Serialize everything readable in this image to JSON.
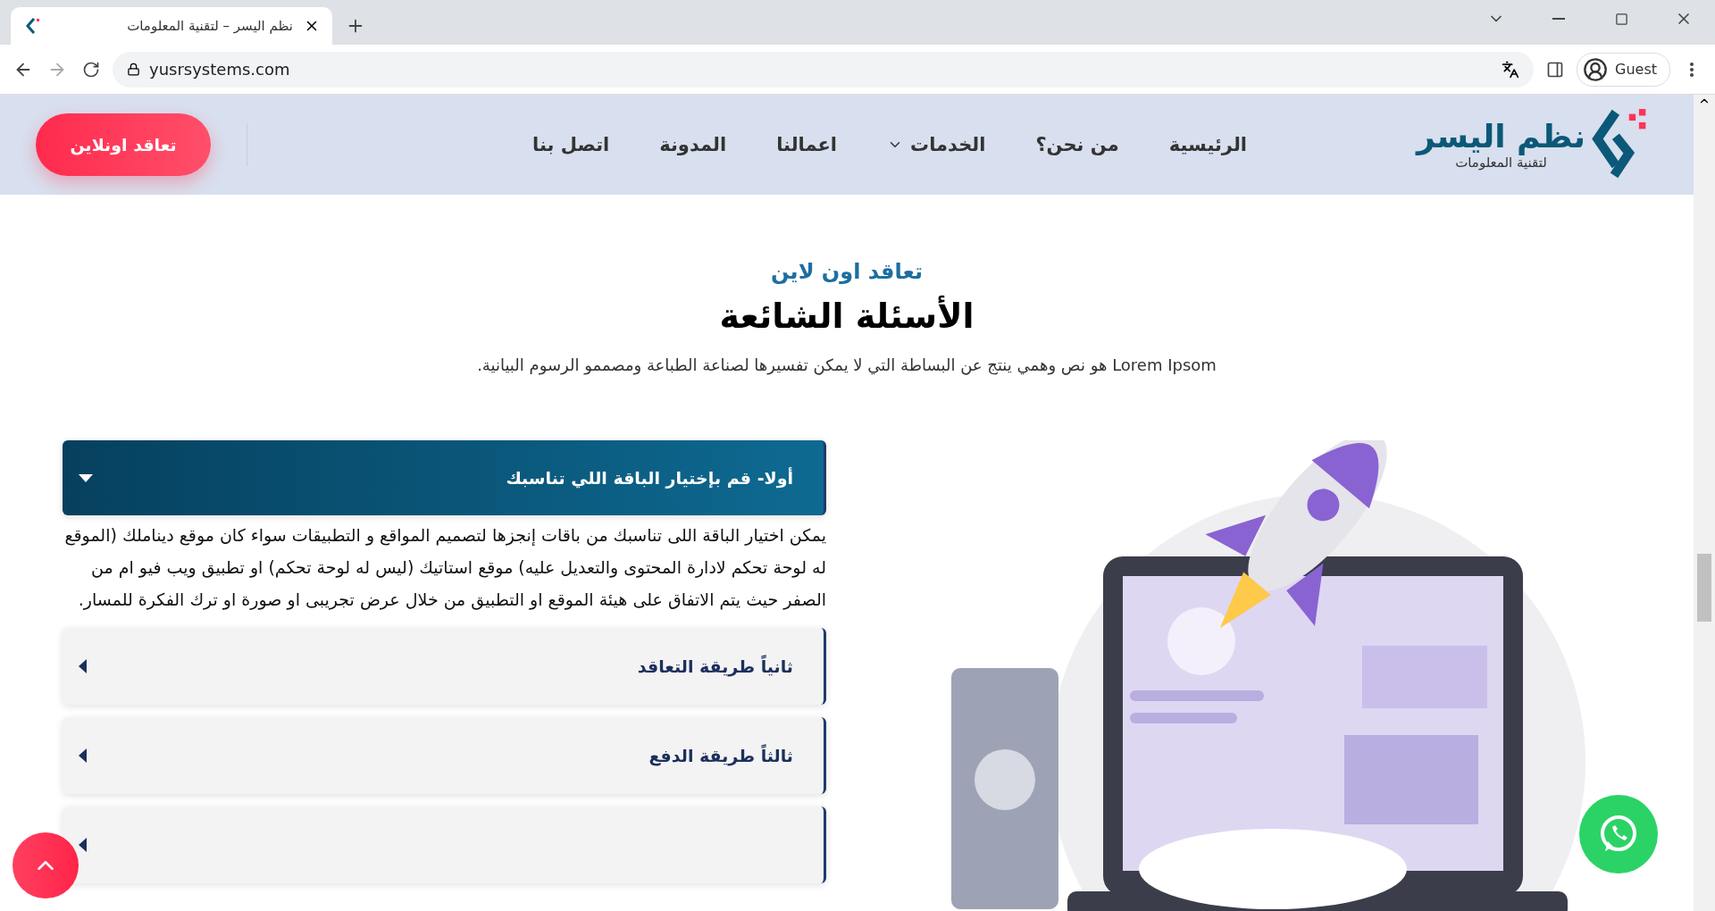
{
  "browser": {
    "tab_title": "نظم اليسر – لتقنية المعلومات",
    "url": "yusrsystems.com",
    "profile": "Guest"
  },
  "nav": {
    "logo_title": "نظم اليسر",
    "logo_subtitle": "لتقنية المعلومات",
    "items": [
      {
        "label": "الرئيسية",
        "has_dropdown": false
      },
      {
        "label": "من نحن؟",
        "has_dropdown": false
      },
      {
        "label": "الخدمات",
        "has_dropdown": true
      },
      {
        "label": "اعمالنا",
        "has_dropdown": false
      },
      {
        "label": "المدونة",
        "has_dropdown": false
      },
      {
        "label": "اتصل بنا",
        "has_dropdown": false
      }
    ],
    "cta": "تعاقد اونلاين"
  },
  "hero": {
    "eyebrow": "تعاقد اون لاين",
    "title": "الأسئلة الشائعة",
    "description": "Lorem Ipsom هو نص وهمي ينتج عن البساطة التي لا يمكن تفسيرها لصناعة الطباعة ومصممو الرسوم البيانية."
  },
  "faq": {
    "items": [
      {
        "title": "أولا- قم بإختيار الباقة اللي تناسبك",
        "expanded": true,
        "body": "يمكن اختيار الباقة اللى تناسبك من باقات إنجزها لتصميم المواقع و التطبيقات سواء كان موقع ديناملك (الموقع له لوحة تحكم لادارة المحتوى والتعديل عليه) موقع استاتيك (ليس له لوحة تحكم) او تطبيق ويب فيو ام من الصفر حيث يتم الاتفاق على هيئة الموقع او التطبيق من خلال عرض تجريبى او صورة او ترك الفكرة للمسار."
      },
      {
        "title": "ثانياً طريقة التعاقد",
        "expanded": false
      },
      {
        "title": "ثالثاً طريقة الدفع",
        "expanded": false
      },
      {
        "expanded": false
      }
    ]
  }
}
